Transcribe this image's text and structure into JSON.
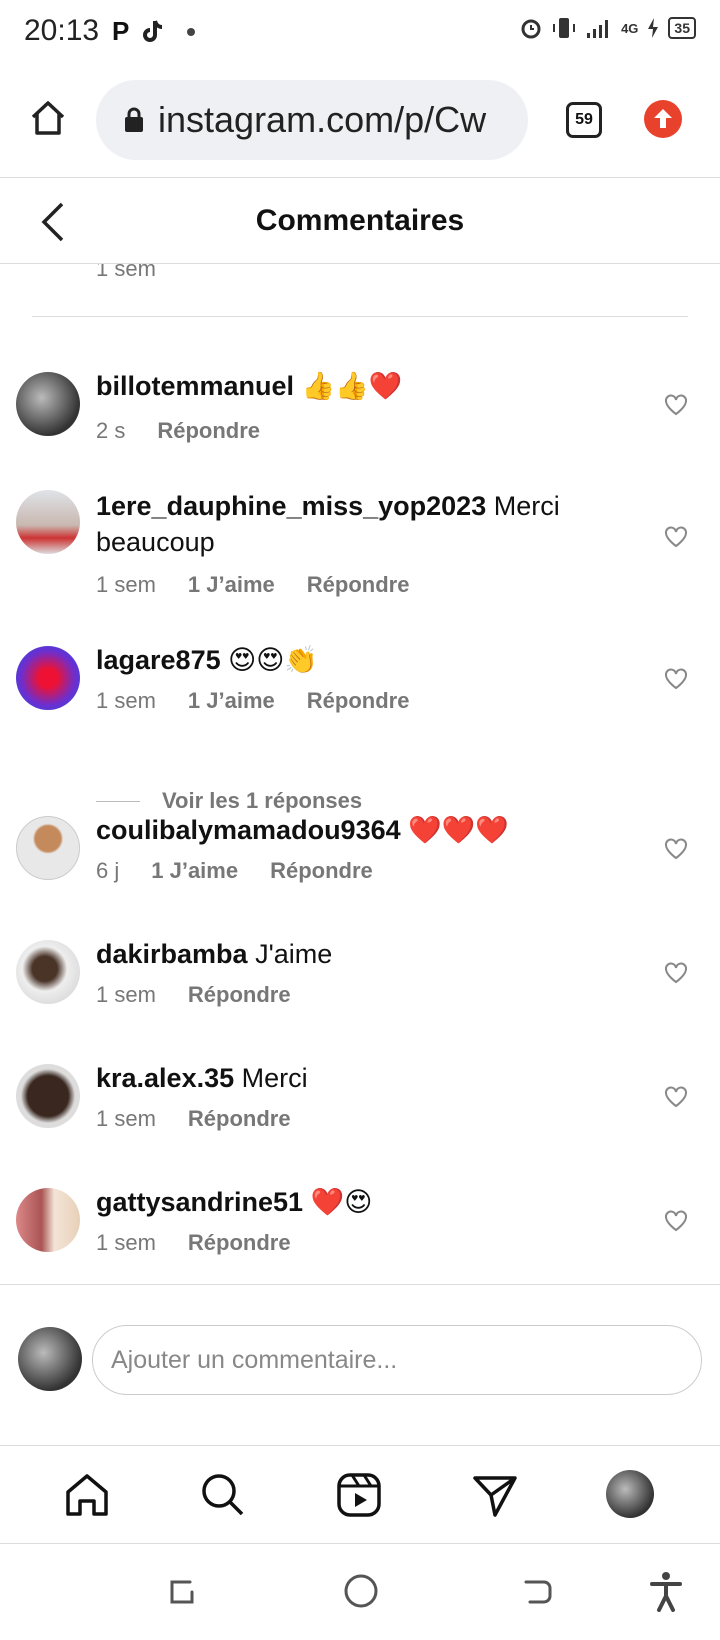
{
  "status_bar": {
    "time": "20:13",
    "signal": "4G",
    "battery": "35"
  },
  "browser": {
    "url": "instagram.com/p/Cw",
    "tab_count": "59"
  },
  "header": {
    "title": "Commentaires"
  },
  "top_meta": {
    "time": "1 sem"
  },
  "comments": [
    {
      "user": "billotemmanuel",
      "text": "👍👍❤️",
      "time": "2 s",
      "likes": "",
      "reply": "Répondre"
    },
    {
      "user": "1ere_dauphine_miss_yop2023",
      "text": "Merci beaucoup",
      "time": "1 sem",
      "likes": "1 J’aime",
      "reply": "Répondre"
    },
    {
      "user": "lagare875",
      "text": "😍😍👏",
      "time": "1 sem",
      "likes": "1 J’aime",
      "reply": "Répondre"
    },
    {
      "user": "coulibalymamadou9364",
      "text": "❤️❤️❤️",
      "time": "6 j",
      "likes": "1 J’aime",
      "reply": "Répondre"
    },
    {
      "user": "dakirbamba",
      "text": "J'aime",
      "time": "1 sem",
      "likes": "",
      "reply": "Répondre"
    },
    {
      "user": "kra.alex.35",
      "text": "Merci",
      "time": "1 sem",
      "likes": "",
      "reply": "Répondre"
    },
    {
      "user": "gattysandrine51",
      "text": "❤️😍",
      "time": "1 sem",
      "likes": "",
      "reply": "Répondre"
    }
  ],
  "view_replies": "Voir les 1 réponses",
  "add_comment": {
    "placeholder": "Ajouter un commentaire..."
  },
  "icons": {
    "home": "home-icon",
    "lock": "lock-icon",
    "back": "back-icon",
    "heart": "heart-icon",
    "search": "search-icon",
    "reels": "reels-icon",
    "send": "send-icon"
  }
}
